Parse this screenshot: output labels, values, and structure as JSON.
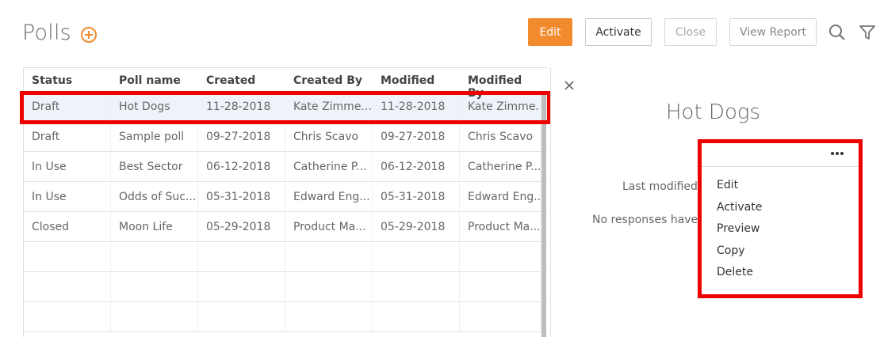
{
  "header": {
    "title": "Polls",
    "buttons": {
      "edit": "Edit",
      "activate": "Activate",
      "close": "Close",
      "view_report": "View Report"
    },
    "icons": [
      "add-circle-icon",
      "search-icon",
      "filter-icon"
    ]
  },
  "table": {
    "columns": [
      "Status",
      "Poll name",
      "Created",
      "Created By",
      "Modified",
      "Modified By"
    ],
    "rows": [
      [
        "Draft",
        "Hot Dogs",
        "11-28-2018",
        "Kate Zimme...",
        "11-28-2018",
        "Kate Zimme..."
      ],
      [
        "Draft",
        "Sample poll",
        "09-27-2018",
        "Chris Scavo",
        "09-27-2018",
        "Chris Scavo"
      ],
      [
        "In Use",
        "Best Sector",
        "06-12-2018",
        "Catherine P...",
        "06-12-2018",
        "Catherine P..."
      ],
      [
        "In Use",
        "Odds of Suc...",
        "05-31-2018",
        "Edward Eng...",
        "05-31-2018",
        "Edward Eng..."
      ],
      [
        "Closed",
        "Moon Life",
        "05-29-2018",
        "Product Ma...",
        "05-29-2018",
        "Product Ma..."
      ]
    ],
    "selected_row": 0
  },
  "detail": {
    "title": "Hot Dogs",
    "last_modified": "Last modified",
    "no_responses": "No responses have b"
  },
  "menu": {
    "items": [
      "Edit",
      "Activate",
      "Preview",
      "Copy",
      "Delete"
    ]
  },
  "colors": {
    "accent": "#f28a2e",
    "highlight": "#ee0000",
    "selected_row_bg": "#eef3fa"
  }
}
